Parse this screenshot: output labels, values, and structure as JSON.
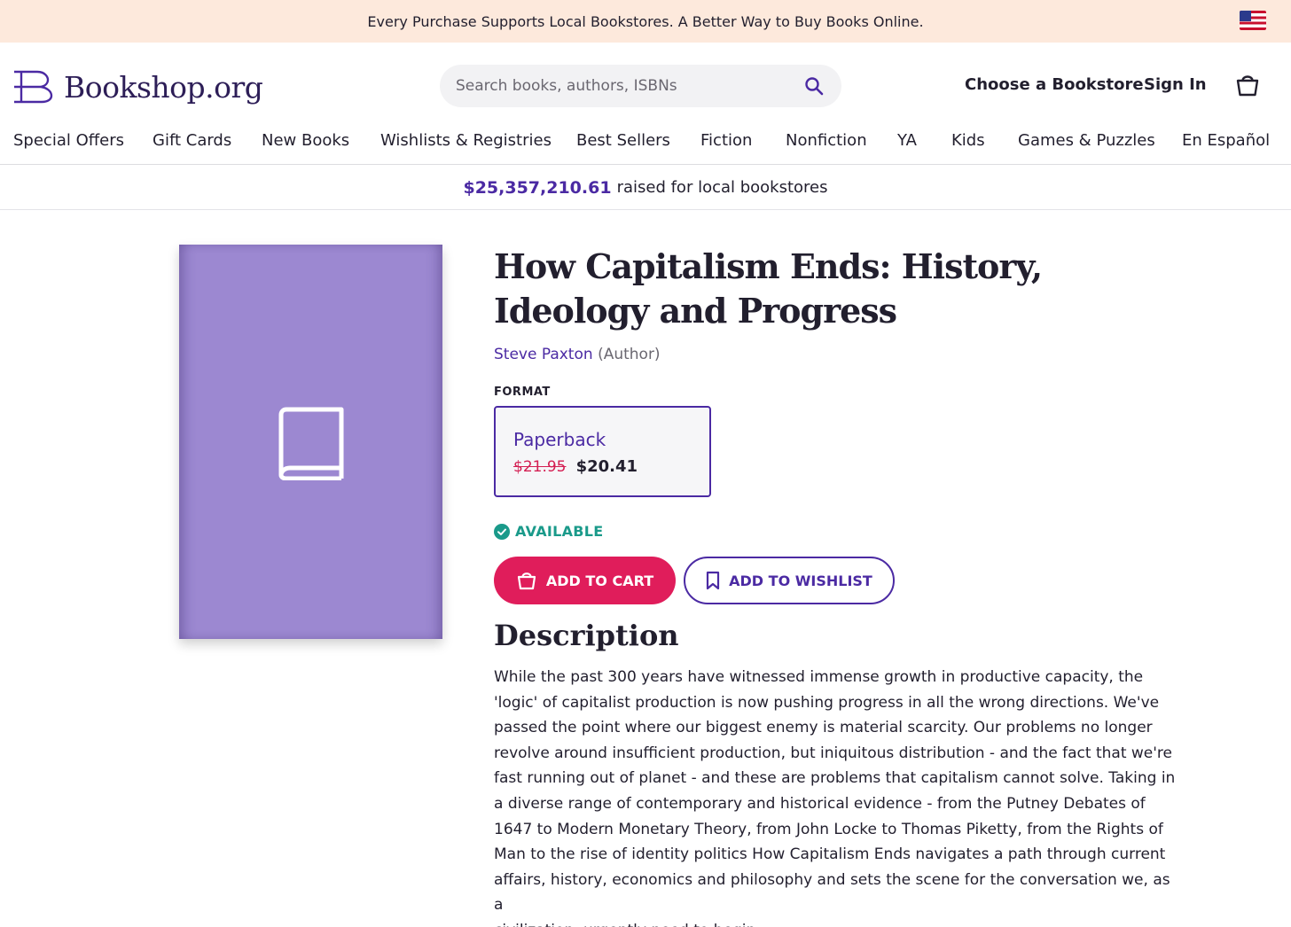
{
  "promo": {
    "text": "Every Purchase Supports Local Bookstores. A Better Way to Buy Books Online."
  },
  "header": {
    "logo_text": "Bookshop.org",
    "search_placeholder": "Search books, authors, ISBNs",
    "choose_bookstore": "Choose a Bookstore",
    "sign_in": "Sign In"
  },
  "nav": {
    "items": [
      "Special Offers",
      "Gift Cards",
      "New Books",
      "Wishlists & Registries",
      "Best Sellers",
      "Fiction",
      "Nonfiction",
      "YA",
      "Kids",
      "Games & Puzzles",
      "En Español"
    ]
  },
  "raised": {
    "amount": "$25,357,210.61",
    "text": "raised for local bookstores"
  },
  "book": {
    "title": "How Capitalism Ends: History, Ideology and Progress",
    "author": "Steve Paxton",
    "author_role": "(Author)",
    "format_label": "FORMAT",
    "format_name": "Paperback",
    "price_old": "$21.95",
    "price_new": "$20.41",
    "availability": "AVAILABLE",
    "add_to_cart": "ADD TO CART",
    "add_to_wishlist": "ADD TO WISHLIST",
    "description_heading": "Description",
    "description_lines": [
      "While the past 300 years have witnessed immense growth in productive capacity, the",
      "'logic' of capitalist production is now pushing progress in all the wrong directions. We've",
      "passed the point where our biggest enemy is material scarcity. Our problems no longer",
      "revolve around insufficient production, but iniquitous distribution - and the fact that we're",
      "fast running out of planet - and these are problems that capitalism cannot solve. Taking in",
      "a diverse range of contemporary and historical evidence - from the Putney Debates of",
      "1647 to Modern Monetary Theory, from John Locke to Thomas Piketty, from the Rights of",
      "Man to the rise of identity politics How Capitalism Ends navigates a path through current",
      "affairs, history, economics and philosophy and sets the scene for the conversation we, as a",
      "civilization, urgently need to begin..."
    ]
  },
  "icons": {
    "flag": "us-flag-icon",
    "search": "search-icon",
    "cart": "shopping-bag-icon",
    "cover": "book-icon",
    "available": "check-circle-icon",
    "wishlist": "bookmark-icon"
  },
  "colors": {
    "accent": "#4b2aa3",
    "promo_bg": "#fde9dc",
    "cart_button": "#e01d5b",
    "available": "#1a9a8a",
    "cover": "#9c88d1"
  }
}
